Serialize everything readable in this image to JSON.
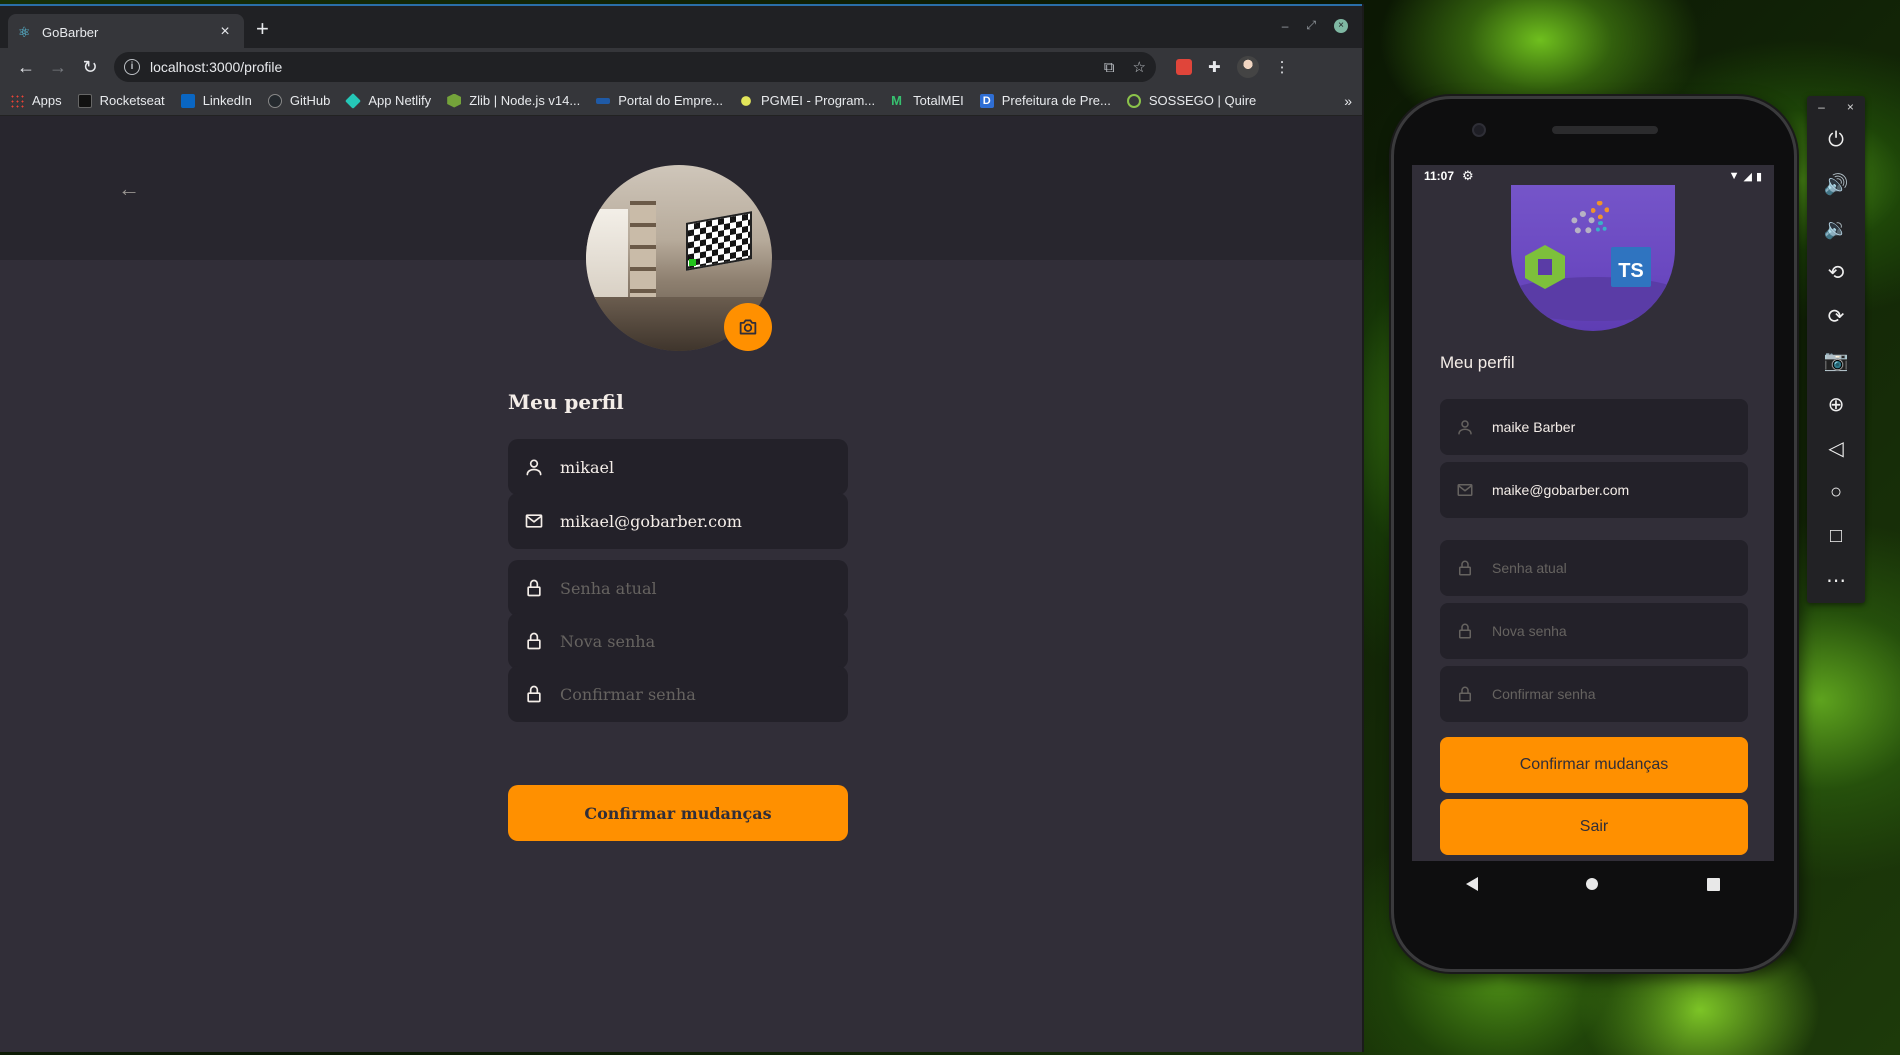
{
  "browser": {
    "tab_title": "GoBarber",
    "tab_close": "×",
    "new_tab": "+",
    "url": "localhost:3000/profile",
    "bookmarks": [
      {
        "label": "Apps",
        "color": "#e8eaed"
      },
      {
        "label": "Rocketseat",
        "color": "#ffffff"
      },
      {
        "label": "LinkedIn",
        "color": "#0a66c2"
      },
      {
        "label": "GitHub",
        "color": "#e8eaed"
      },
      {
        "label": "App Netlify",
        "color": "#25c7b7"
      },
      {
        "label": "Zlib | Node.js v14...",
        "color": "#74a33a"
      },
      {
        "label": "Portal do Empre...",
        "color": "#1f5aa6"
      },
      {
        "label": "PGMEI - Program...",
        "color": "#e2e55a"
      },
      {
        "label": "TotalMEI",
        "color": "#37c06f"
      },
      {
        "label": "Prefeitura de Pre...",
        "color": "#2f6ed4"
      },
      {
        "label": "SOSSEGO | Quire",
        "color": "#8bc34a"
      }
    ],
    "bookmarks_more": "»"
  },
  "web_profile": {
    "title": "Meu perfil",
    "name_value": "mikael",
    "email_value": "mikael@gobarber.com",
    "current_password_placeholder": "Senha atual",
    "new_password_placeholder": "Nova senha",
    "confirm_password_placeholder": "Confirmar senha",
    "submit_label": "Confirmar mudanças"
  },
  "mobile": {
    "time": "11:07",
    "title": "Meu perfil",
    "name_value": "maike Barber",
    "email_value": "maike@gobarber.com",
    "current_password_placeholder": "Senha atual",
    "new_password_placeholder": "Nova senha",
    "confirm_password_placeholder": "Confirmar senha",
    "submit_label": "Confirmar mudanças",
    "logout_label": "Sair",
    "avatar_badge": "TS"
  },
  "colors": {
    "accent": "#ff9000",
    "page_bg": "#312e38",
    "input_bg": "#232129",
    "header_bg": "#28262e"
  }
}
